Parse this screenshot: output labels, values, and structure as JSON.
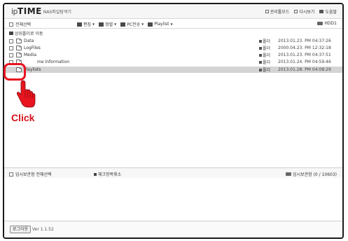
{
  "header": {
    "logo_ip": "ip",
    "logo_time": "TIME",
    "logo_sub": "NAS파일탐색기",
    "links": [
      {
        "label": "관리툴모드",
        "icon": "checkbox-icon"
      },
      {
        "label": "다시보기",
        "icon": "refresh-icon"
      },
      {
        "label": "도움말",
        "icon": "help-icon"
      }
    ]
  },
  "toolbar": {
    "select_all": "전체선택",
    "tools": [
      {
        "label": "편집",
        "icon": "edit-icon"
      },
      {
        "label": "정렬",
        "icon": "sort-icon"
      },
      {
        "label": "PC전송",
        "icon": "pc-transfer-icon"
      },
      {
        "label": "Playlist",
        "icon": "playlist-icon"
      }
    ],
    "disk": "HDD1"
  },
  "breadcrumb": "상위폴더로 이동",
  "files": [
    {
      "name": "Data",
      "type": "폴더",
      "date": "2013.01.23. PM 04:37:26",
      "selected": false
    },
    {
      "name": "LogFiles",
      "type": "폴더",
      "date": "2000.04.23. PM 12:32:18",
      "selected": false
    },
    {
      "name": "Media",
      "type": "폴더",
      "date": "2013.01.23. PM 04:37:51",
      "selected": false
    },
    {
      "name": "me Information",
      "type": "폴더",
      "date": "2013.01.24. PM 04:59:46",
      "selected": false
    },
    {
      "name": "Playlists",
      "type": "폴더",
      "date": "2013.01.28. PM 04:08:29",
      "selected": true
    }
  ],
  "annotation": {
    "click_label": "Click",
    "color": "#e8141f"
  },
  "temp": {
    "label": "임시보관함 전체선택",
    "cancel": "체크항목취소",
    "storage": "임시보관함 (0 / 10603)"
  },
  "footer": {
    "logout": "로그아웃",
    "version": "Ver 1.1.52"
  }
}
